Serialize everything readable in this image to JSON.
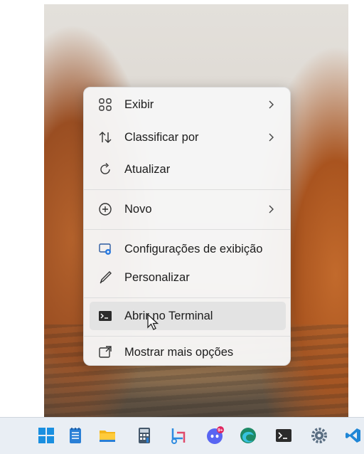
{
  "context_menu": {
    "items": [
      {
        "label": "Exibir",
        "icon": "view-grid-icon",
        "has_submenu": true
      },
      {
        "label": "Classificar por",
        "icon": "sort-icon",
        "has_submenu": true
      },
      {
        "label": "Atualizar",
        "icon": "refresh-icon",
        "has_submenu": false
      },
      {
        "label": "Novo",
        "icon": "new-plus-icon",
        "has_submenu": true
      },
      {
        "label": "Configurações de exibição",
        "icon": "display-settings-icon",
        "has_submenu": false
      },
      {
        "label": "Personalizar",
        "icon": "brush-icon",
        "has_submenu": false
      },
      {
        "label": "Abrir no Terminal",
        "icon": "terminal-icon",
        "has_submenu": false,
        "highlighted": true
      },
      {
        "label": "Mostrar mais opções",
        "icon": "more-options-icon",
        "has_submenu": false
      }
    ]
  },
  "taskbar": {
    "icons": [
      {
        "name": "windows-start-icon",
        "color": "#1a8fe0"
      },
      {
        "name": "notepad-icon",
        "color": "#2a7fd6"
      },
      {
        "name": "file-explorer-icon",
        "color": "#f3b51c"
      },
      {
        "name": "calculator-icon",
        "color": "#44576a"
      },
      {
        "name": "snipping-tool-icon",
        "color": "#2e8be0"
      },
      {
        "name": "discord-icon",
        "color": "#5865f2",
        "badge": "9+"
      },
      {
        "name": "edge-icon",
        "color": "#1e8a66"
      },
      {
        "name": "terminal-icon",
        "color": "#2b2b2b"
      },
      {
        "name": "settings-icon",
        "color": "#5a6e82"
      },
      {
        "name": "vscode-icon",
        "color": "#1f86d6"
      }
    ]
  }
}
